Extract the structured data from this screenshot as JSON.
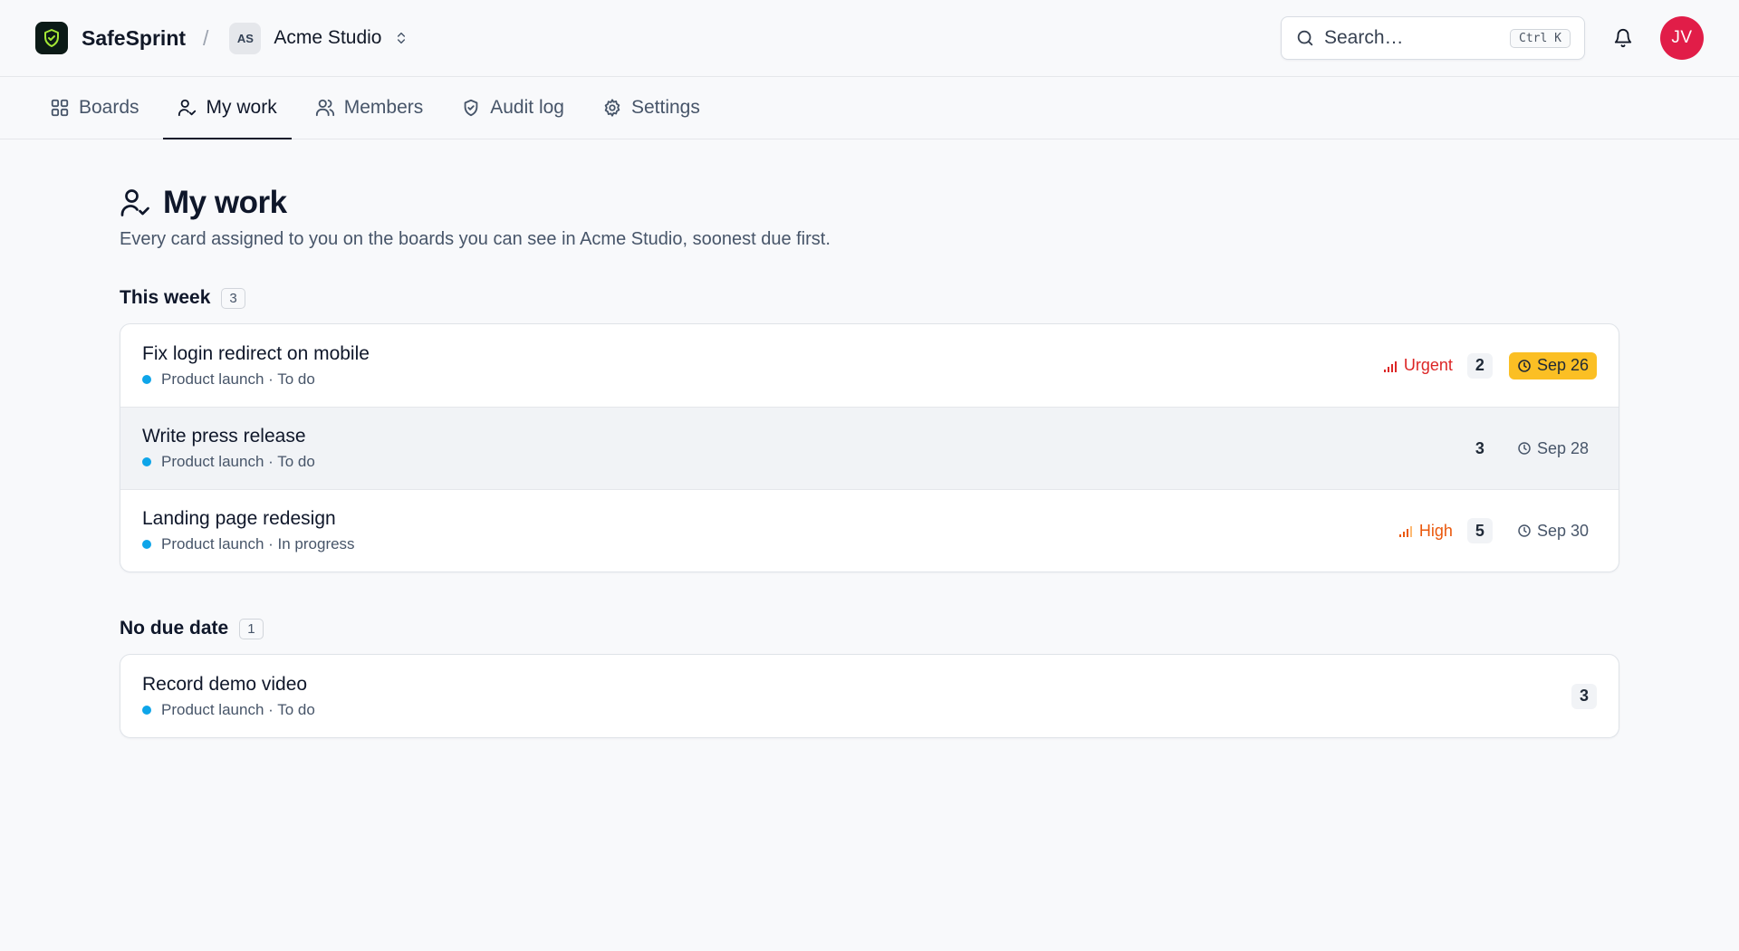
{
  "app": {
    "name": "SafeSprint",
    "separator": "/"
  },
  "workspace": {
    "initials": "AS",
    "name": "Acme Studio"
  },
  "search": {
    "placeholder": "Search…",
    "shortcut": "Ctrl K"
  },
  "user": {
    "initials": "JV",
    "avatar_color": "#e11d48"
  },
  "nav": {
    "tabs": [
      {
        "label": "Boards",
        "icon": "grid-icon",
        "active": false
      },
      {
        "label": "My work",
        "icon": "user-check-icon",
        "active": true
      },
      {
        "label": "Members",
        "icon": "users-icon",
        "active": false
      },
      {
        "label": "Audit log",
        "icon": "shield-check-icon",
        "active": false
      },
      {
        "label": "Settings",
        "icon": "gear-icon",
        "active": false
      }
    ]
  },
  "page": {
    "title": "My work",
    "subtitle": "Every card assigned to you on the boards you can see in Acme Studio, soonest due first."
  },
  "sections": [
    {
      "label": "This week",
      "count": "3",
      "cards": [
        {
          "title": "Fix login redirect on mobile",
          "meta": "Product launch · To do",
          "priority": "Urgent",
          "points": "2",
          "due": "Sep 26",
          "due_highlight": true
        },
        {
          "title": "Write press release",
          "meta": "Product launch · To do",
          "priority": "",
          "points": "3",
          "due": "Sep 28",
          "due_highlight": false
        },
        {
          "title": "Landing page redesign",
          "meta": "Product launch · In progress",
          "priority": "High",
          "points": "5",
          "due": "Sep 30",
          "due_highlight": false
        }
      ]
    },
    {
      "label": "No due date",
      "count": "1",
      "cards": [
        {
          "title": "Record demo video",
          "meta": "Product launch · To do",
          "priority": "",
          "points": "3",
          "due": "",
          "due_highlight": false
        }
      ]
    }
  ],
  "colors": {
    "board_dot": "#0ea5e9",
    "urgent": "#dc2626",
    "high": "#ea580c",
    "due_highlight": "#fbbf24",
    "logo_shield": "#a3e635"
  }
}
